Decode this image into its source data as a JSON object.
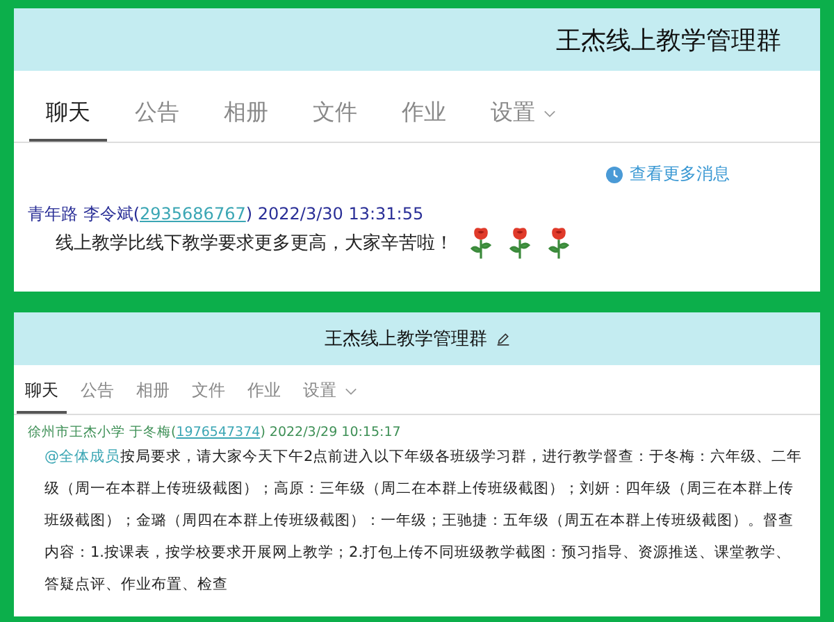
{
  "panels": [
    {
      "kind": "large",
      "title": "王杰线上教学管理群",
      "editable": false,
      "tabs": [
        {
          "label": "聊天",
          "selected": true,
          "dropdown": false
        },
        {
          "label": "公告",
          "selected": false,
          "dropdown": false
        },
        {
          "label": "相册",
          "selected": false,
          "dropdown": false
        },
        {
          "label": "文件",
          "selected": false,
          "dropdown": false
        },
        {
          "label": "作业",
          "selected": false,
          "dropdown": false
        },
        {
          "label": "设置",
          "selected": false,
          "dropdown": true
        }
      ],
      "more_link": "查看更多消息",
      "message": {
        "sender": "青年路 李令斌(",
        "id": "2935686767",
        "time": ") 2022/3/30 13:31:55",
        "text": "线上教学比线下教学要求更多更高，大家辛苦啦！",
        "roses": true
      }
    },
    {
      "kind": "small",
      "title": "王杰线上教学管理群",
      "editable": true,
      "tabs": [
        {
          "label": "聊天",
          "selected": true,
          "dropdown": false
        },
        {
          "label": "公告",
          "selected": false,
          "dropdown": false
        },
        {
          "label": "相册",
          "selected": false,
          "dropdown": false
        },
        {
          "label": "文件",
          "selected": false,
          "dropdown": false
        },
        {
          "label": "作业",
          "selected": false,
          "dropdown": false
        },
        {
          "label": "设置",
          "selected": false,
          "dropdown": true
        }
      ],
      "message": {
        "sender": "徐州市王杰小学  于冬梅(",
        "id": "1976547374",
        "time": ") 2022/3/29 10:15:17",
        "mention": "@全体成员",
        "text": "按局要求，请大家今天下午2点前进入以下年级各班级学习群，进行教学督查：于冬梅：六年级、二年级（周一在本群上传班级截图）；高原：三年级（周二在本群上传班级截图）；刘妍：四年级（周三在本群上传班级截图）；金璐（周四在本群上传班级截图）：一年级；王驰捷：五年级（周五在本群上传班级截图）。督查内容：1.按课表，按学校要求开展网上教学；2.打包上传不同班级教学截图：预习指导、资源推送、课堂教学、答疑点评、作业布置、检查",
        "roses": false
      }
    }
  ]
}
